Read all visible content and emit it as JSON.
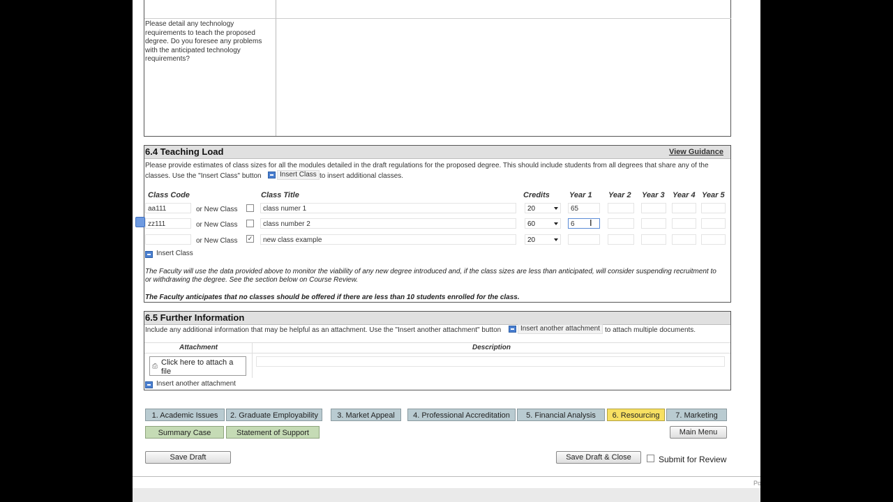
{
  "tech_section": {
    "question": "Please detail any technology requirements to teach the proposed degree. Do you foresee any problems with the anticipated technology requirements?"
  },
  "teaching_load": {
    "title": "6.4 Teaching Load",
    "guidance_link": "View Guidance",
    "intro_line1": "Please provide estimates of class sizes for all the modules detailed in the draft regulations for the proposed degree. This should include students from all degrees that share any of the",
    "intro_line2_a": "classes. Use the \"Insert Class\" button",
    "intro_button": "Insert Class",
    "intro_line2_b": "to insert additional classes.",
    "headers": {
      "class_code": "Class Code",
      "class_title": "Class Title",
      "credits": "Credits",
      "year1": "Year 1",
      "year2": "Year 2",
      "year3": "Year 3",
      "year4": "Year 4",
      "year5": "Year 5"
    },
    "or_new_class": "or New Class",
    "rows": [
      {
        "code": "aa111",
        "new_class": false,
        "title": "class numer 1",
        "credits": "20",
        "year1": "65"
      },
      {
        "code": "zz111",
        "new_class": false,
        "title": "class number 2",
        "credits": "60",
        "year1": "6"
      },
      {
        "code": "",
        "new_class": true,
        "title": "new class example",
        "credits": "20",
        "year1": ""
      }
    ],
    "insert_class_link": "Insert Class",
    "note_line1": "The Faculty will use the data provided above to monitor the viability of any new degree introduced and, if the class sizes are less than anticipated, will consider suspending recruitment to",
    "note_line2": "or withdrawing the degree. See the section below on Course Review.",
    "note_bold": "The Faculty anticipates that no classes should be offered if there are less than 10 students enrolled for the class."
  },
  "further_info": {
    "title": "6.5 Further Information",
    "intro_a": "Include any additional information that may be helpful as an attachment. Use the \"Insert another attachment\" button",
    "intro_button": "Insert another attachment",
    "intro_b": "to attach multiple documents.",
    "col_attachment": "Attachment",
    "col_description": "Description",
    "attach_button": "Click here to attach a file",
    "insert_link": "Insert another attachment"
  },
  "nav_tabs": [
    "1. Academic Issues",
    "2. Graduate Employability",
    "3. Market Appeal",
    "4. Professional Accreditation",
    "5. Financial Analysis",
    "6. Resourcing",
    "7. Marketing"
  ],
  "active_tab": "6. Resourcing",
  "summary_case": "Summary Case",
  "statement_support": "Statement of Support",
  "main_menu": "Main Menu",
  "save_draft": "Save Draft",
  "save_draft_close": "Save Draft & Close",
  "submit_review": "Submit for Review",
  "footer_fragment": "Po",
  "colors": {
    "tab": "#b9cbd1",
    "tab_active": "#f7e062",
    "tab_green": "#c5dbb5",
    "section_header": "#e0e0e0"
  }
}
